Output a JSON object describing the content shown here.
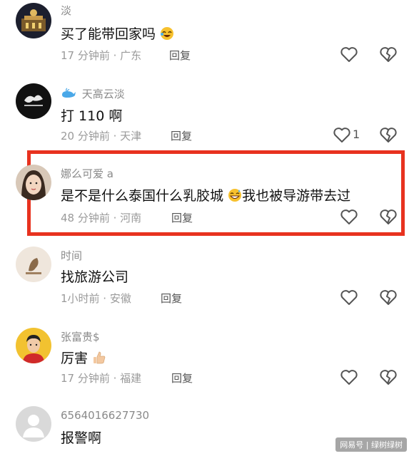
{
  "comments": [
    {
      "username": "淡",
      "content": "买了能带回家吗",
      "time": "17 分钟前 · 广东",
      "reply": "回复",
      "likes": ""
    },
    {
      "username": "天高云淡",
      "content": "打 110 啊",
      "time": "20 分钟前 · 天津",
      "reply": "回复",
      "likes": "1"
    },
    {
      "username": "娜么可爱 a",
      "content_pre": "是不是什么泰国什么乳胶城",
      "content_post": "我也被导游带去过",
      "time": "48 分钟前 · 河南",
      "reply": "回复",
      "likes": ""
    },
    {
      "username": "时间",
      "content": "找旅游公司",
      "time": "1小时前 · 安徽",
      "reply": "回复",
      "likes": ""
    },
    {
      "username": "张富贵$",
      "content": "厉害",
      "time": "17 分钟前 · 福建",
      "reply": "回复",
      "likes": ""
    },
    {
      "username": "6564016627730",
      "content": "报警啊",
      "time": "",
      "reply": "",
      "likes": ""
    }
  ],
  "watermark": "网易号 | 绿树绿树",
  "colors": {
    "highlight_border": "#e8321f",
    "meta_text": "#9a9a9a",
    "username_text": "#8a8a8a"
  },
  "icons": [
    "heart-icon",
    "broken-heart-icon",
    "whale-icon",
    "laughing-emoji-icon",
    "grinning-sweat-emoji-icon",
    "thumbs-up-emoji-icon"
  ]
}
